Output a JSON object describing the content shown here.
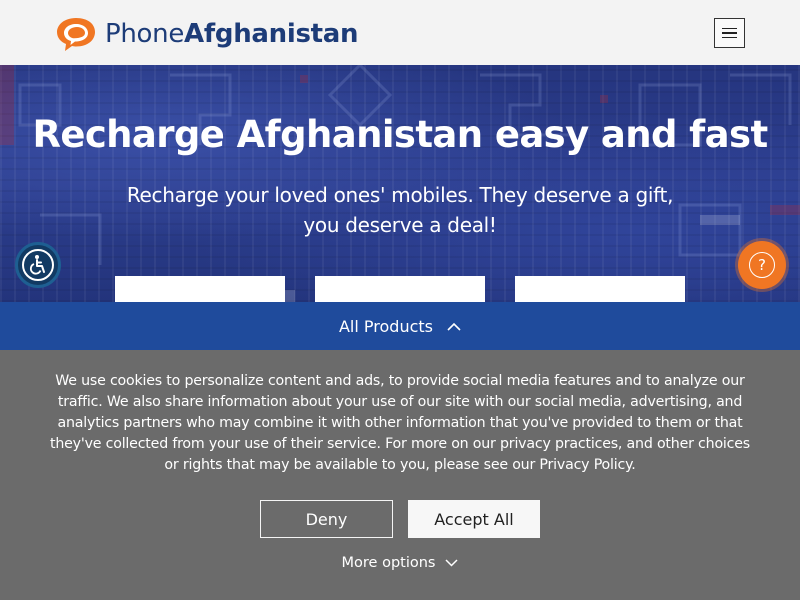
{
  "header": {
    "logo_part1": "Phone",
    "logo_part2": "Afghanistan",
    "menu_icon": "hamburger-menu-icon"
  },
  "hero": {
    "title": "Recharge Afghanistan easy and fast",
    "subtitle": "Recharge your loved ones' mobiles. They deserve a gift, you deserve a deal!",
    "help_glyph": "?"
  },
  "products_bar": {
    "label": "All Products",
    "icon": "chevron-up-icon"
  },
  "cookie_banner": {
    "text": "We use cookies to personalize content and ads, to provide social media features and to analyze our traffic. We also share information about your use of our site with our social media, advertising, and analytics partners who may combine it with other information that you've provided to them or that they've collected from your use of their service. For more on our privacy practices, and other choices or rights that may be available to you, please see our Privacy Policy.",
    "deny_label": "Deny",
    "accept_label": "Accept All",
    "more_options_label": "More options"
  },
  "colors": {
    "brand_blue": "#1d3c78",
    "brand_orange": "#f07623",
    "products_bar": "#1f4b9c",
    "cookie_bg": "#6b6b6b"
  }
}
